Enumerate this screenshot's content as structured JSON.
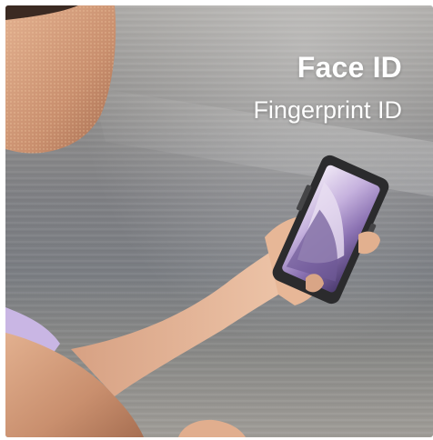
{
  "headline": "Face ID",
  "subheadline": "Fingerprint ID",
  "colors": {
    "text": "#ffffff",
    "water": "#7f8084",
    "skin": "#c98f6e",
    "phone_body": "#2b2b2d",
    "screen_accent": "#b59bd4"
  },
  "icons": [
    "person-face-mesh",
    "hand-holding-phone",
    "rugged-smartphone"
  ]
}
